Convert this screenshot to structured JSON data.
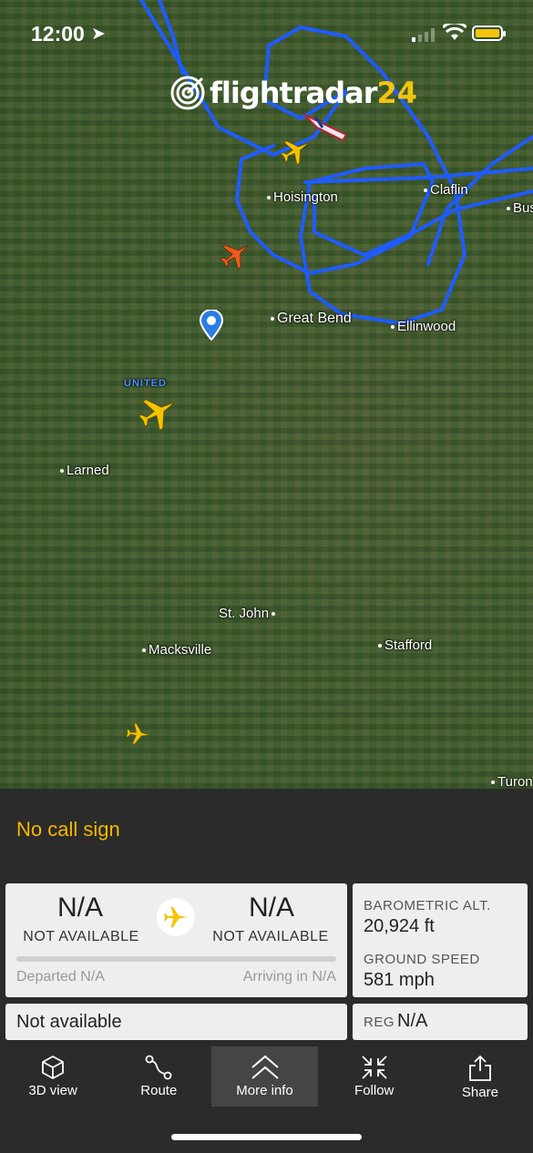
{
  "status_bar": {
    "time": "12:00",
    "location_glyph": "➤"
  },
  "map": {
    "logo_text": "flightradar",
    "logo_number": "24",
    "cities": [
      "Hoisington",
      "Claflin",
      "Bus",
      "Great Bend",
      "Ellinwood",
      "Larned",
      "St. John",
      "Macksville",
      "Stafford",
      "Turon"
    ],
    "airline_label": "UNITED"
  },
  "flight": {
    "callsign": "No call sign",
    "origin": {
      "code": "N/A",
      "name": "NOT AVAILABLE"
    },
    "destination": {
      "code": "N/A",
      "name": "NOT AVAILABLE"
    },
    "departed": "Departed N/A",
    "arriving": "Arriving in N/A",
    "progress": 0,
    "aircraft": "Not available",
    "altitude_label": "BAROMETRIC ALT.",
    "altitude_value": "20,924 ft",
    "speed_label": "GROUND SPEED",
    "speed_value": "581 mph",
    "reg_label": "REG",
    "reg_value": "N/A"
  },
  "toolbar": [
    {
      "label": "3D view",
      "icon": "cube-icon"
    },
    {
      "label": "Route",
      "icon": "route-icon"
    },
    {
      "label": "More info",
      "icon": "chevrons-up-icon",
      "active": true
    },
    {
      "label": "Follow",
      "icon": "collapse-arrows-icon"
    },
    {
      "label": "Share",
      "icon": "share-icon"
    }
  ],
  "colors": {
    "accent": "#f5b800",
    "track": "#1f5bff",
    "panel": "#2b2b2b"
  }
}
